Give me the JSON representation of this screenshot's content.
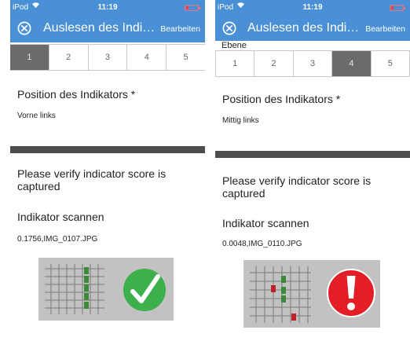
{
  "colors": {
    "navbar": "#4a90d6",
    "step_active": "#6b6b6b",
    "divider": "#4d4d4d",
    "success": "#3cb04a",
    "error": "#e41e26",
    "scan_bg": "#c2c2c2",
    "bar_green": "#3a8a3a",
    "bar_red": "#c0202a"
  },
  "screens": [
    {
      "status": {
        "carrier": "iPod",
        "time": "11:19"
      },
      "header": {
        "title": "Auslesen des Indi…",
        "edit_label": "Bearbeiten"
      },
      "section_label": "",
      "steps": [
        "1",
        "2",
        "3",
        "4",
        "5"
      ],
      "active_step": "1",
      "position_label": "Position des Indikators *",
      "position_value": "Vorne links",
      "verify_text": "Please verify indicator score is captured",
      "scan_label": "Indikator scannen",
      "scan_value": "0.1756,IMG_0107.JPG",
      "result_icon": "checkmark-icon"
    },
    {
      "status": {
        "carrier": "iPod",
        "time": "11:19"
      },
      "header": {
        "title": "Auslesen des Indi…",
        "edit_label": "Bearbeiten"
      },
      "section_label": "Ebene",
      "steps": [
        "1",
        "2",
        "3",
        "4",
        "5"
      ],
      "active_step": "4",
      "position_label": "Position des Indikators *",
      "position_value": "Mittig links",
      "verify_text": "Please verify indicator score is captured",
      "scan_label": "Indikator scannen",
      "scan_value": "0.0048,IMG_0110.JPG",
      "result_icon": "exclamation-icon"
    }
  ]
}
